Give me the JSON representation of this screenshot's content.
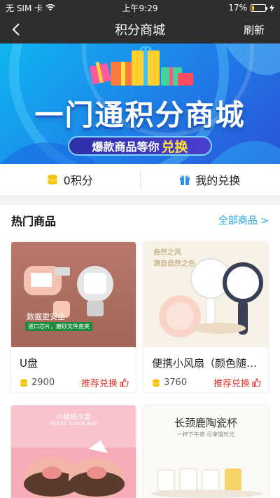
{
  "status": {
    "carrier": "无 SIM 卡",
    "time": "上午9:29",
    "battery": "17%",
    "battery_level": 0.17
  },
  "nav": {
    "title": "积分商城",
    "refresh": "刷新"
  },
  "banner": {
    "headline": "一门通积分商城",
    "tagline": "爆款商品等你",
    "highlight": "兑换"
  },
  "points": {
    "points_label": "0积分",
    "exchange_label": "我的兑换"
  },
  "section": {
    "title": "热门商品",
    "more": "全部商品 >"
  },
  "products": [
    {
      "name": "U盘",
      "price": "2900",
      "tag": "推荐兑换",
      "img_text": "数据更安全",
      "img_sub": "进口芯片，磨砂文件直夹"
    },
    {
      "name": "便携小风扇（颜色随…",
      "price": "3760",
      "tag": "推荐兑换",
      "img_text": "自然之风",
      "img_sub": "源自自然之色"
    },
    {
      "name": "",
      "price": "",
      "tag": "",
      "img_text": "小猪纸巾盒",
      "img_sub": "PIGLET TISSUE BOX"
    },
    {
      "name": "",
      "price": "",
      "tag": "",
      "img_text": "长颈鹿陶瓷杯",
      "img_sub": "一杯下午茶 尽享慢时光"
    }
  ],
  "colors": {
    "bar": "#2e2e2e",
    "accent": "#1fa3e0",
    "tag": "#e0312e",
    "coin": "#f5c400"
  }
}
